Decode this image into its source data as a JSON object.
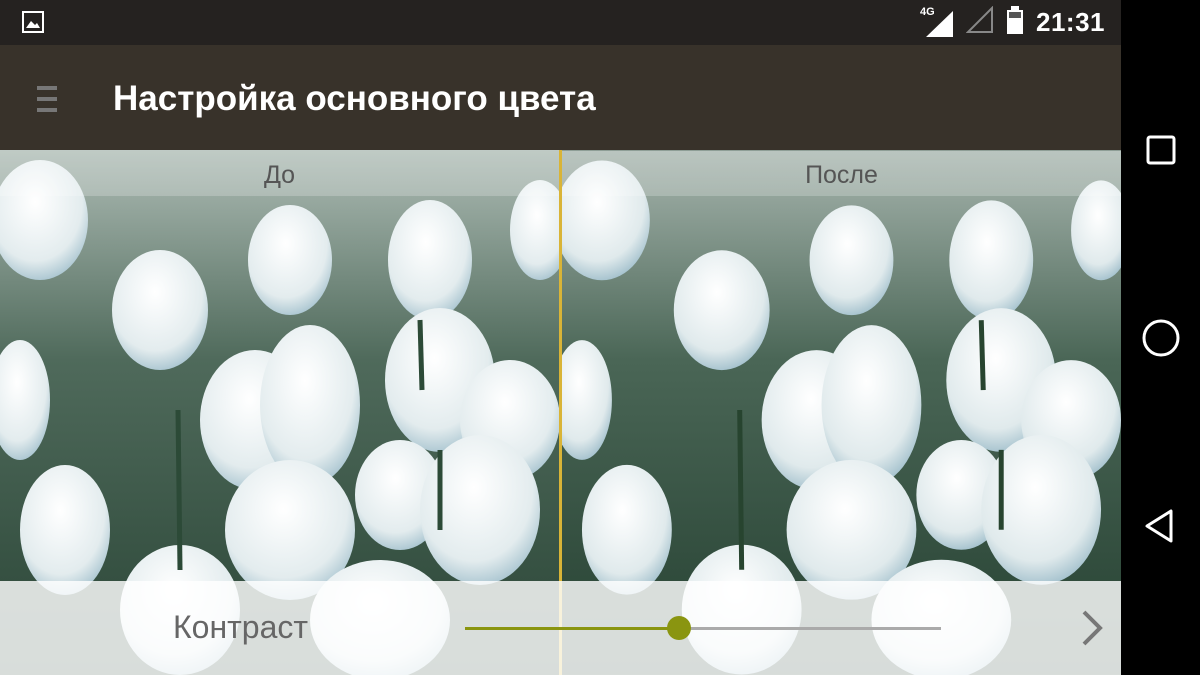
{
  "status_bar": {
    "left_icon": "image-icon",
    "network_type": "4G",
    "time": "21:31"
  },
  "app_bar": {
    "menu_icon": "menu-icon",
    "title": "Настройка основного цвета"
  },
  "compare": {
    "before_label": "До",
    "after_label": "После",
    "divider_color": "#d9b437"
  },
  "control": {
    "label": "Контраст",
    "slider_value_fraction": 0.45,
    "accent_color": "#8a9510",
    "next_icon": "chevron-right-icon"
  },
  "nav_bar": {
    "recents_icon": "square-icon",
    "home_icon": "circle-icon",
    "back_icon": "triangle-back-icon"
  }
}
